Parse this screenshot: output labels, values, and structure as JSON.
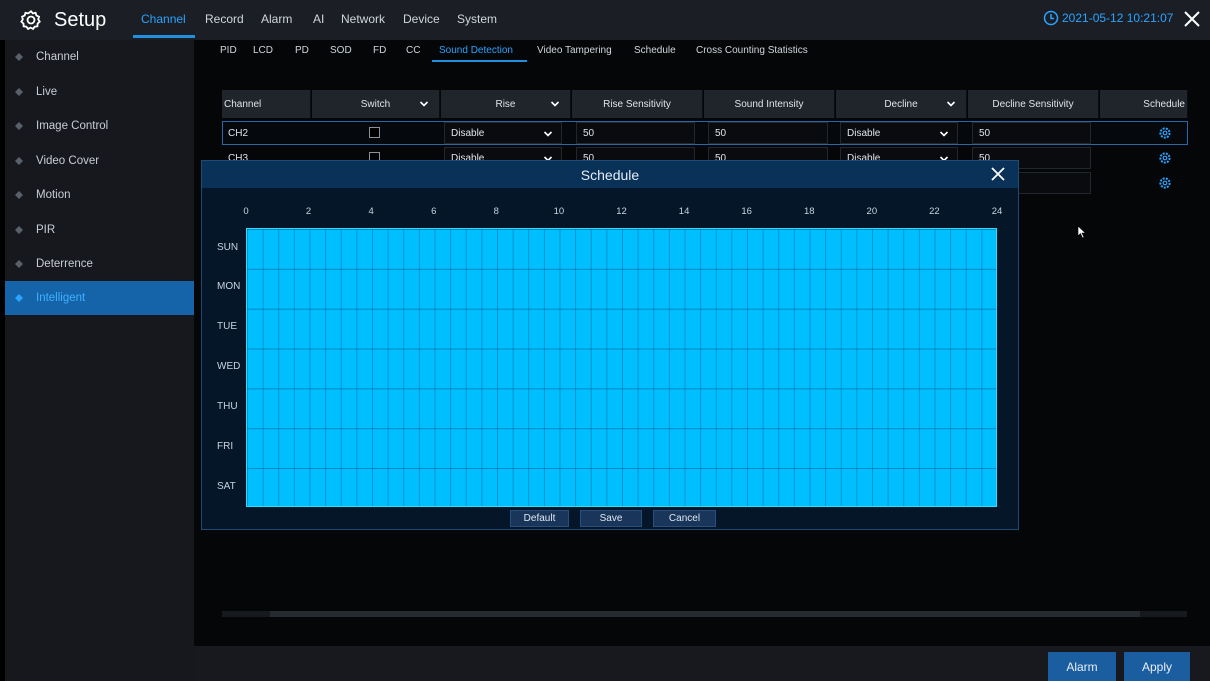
{
  "app": {
    "title": "Setup"
  },
  "main_tabs": [
    {
      "label": "Channel"
    },
    {
      "label": "Record"
    },
    {
      "label": "Alarm"
    },
    {
      "label": "AI"
    },
    {
      "label": "Network"
    },
    {
      "label": "Device"
    },
    {
      "label": "System"
    }
  ],
  "datetime": "2021-05-12 10:21:07",
  "sidebar": {
    "items": [
      {
        "label": "Channel"
      },
      {
        "label": "Live"
      },
      {
        "label": "Image Control"
      },
      {
        "label": "Video Cover"
      },
      {
        "label": "Motion"
      },
      {
        "label": "PIR"
      },
      {
        "label": "Deterrence"
      },
      {
        "label": "Intelligent"
      }
    ]
  },
  "sub_tabs": [
    {
      "label": "PID"
    },
    {
      "label": "LCD"
    },
    {
      "label": "PD"
    },
    {
      "label": "SOD"
    },
    {
      "label": "FD"
    },
    {
      "label": "CC"
    },
    {
      "label": "Sound Detection"
    },
    {
      "label": "Video Tampering"
    },
    {
      "label": "Schedule"
    },
    {
      "label": "Cross Counting Statistics"
    }
  ],
  "table": {
    "headers": [
      "Channel",
      "Switch",
      "Rise",
      "Rise Sensitivity",
      "Sound Intensity",
      "Decline",
      "Decline Sensitivity",
      "Schedule"
    ],
    "rows": [
      {
        "channel": "CH2",
        "rise": "Disable",
        "rise_sensitivity": "50",
        "sound_intensity": "50",
        "decline": "Disable",
        "decline_sensitivity": "50"
      },
      {
        "channel": "CH3",
        "rise": "Disable",
        "rise_sensitivity": "50",
        "sound_intensity": "50",
        "decline": "Disable",
        "decline_sensitivity": "50"
      }
    ]
  },
  "dialog": {
    "title": "Schedule",
    "hours": [
      "0",
      "2",
      "4",
      "6",
      "8",
      "10",
      "12",
      "14",
      "16",
      "18",
      "20",
      "22",
      "24"
    ],
    "days": [
      "SUN",
      "MON",
      "TUE",
      "WED",
      "THU",
      "FRI",
      "SAT"
    ],
    "buttons": {
      "default": "Default",
      "save": "Save",
      "cancel": "Cancel"
    },
    "fill_color": "#00bfff"
  },
  "bottom": {
    "alarm": "Alarm",
    "apply": "Apply"
  },
  "colors": {
    "accent": "#2aa4ff",
    "active_bg": "#1563a8",
    "button_bg": "#1a5e9f"
  }
}
